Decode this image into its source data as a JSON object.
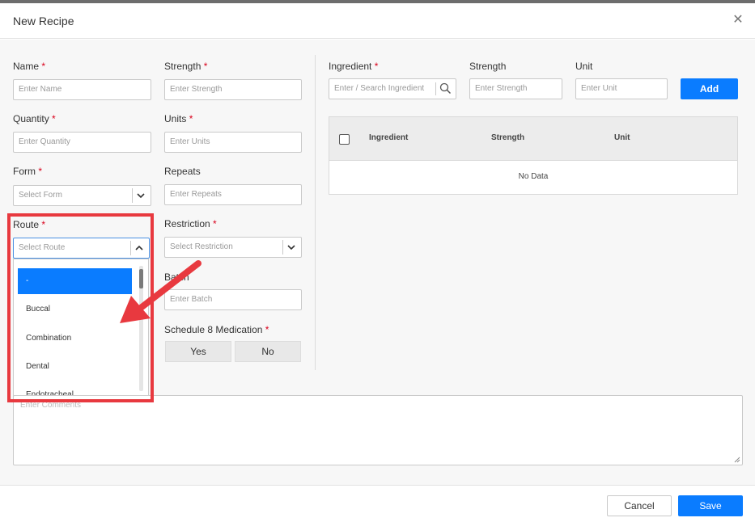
{
  "dialog": {
    "title": "New Recipe",
    "close_icon": "close-icon"
  },
  "fields": {
    "name": {
      "label": "Name",
      "required_mark": "*",
      "placeholder": "Enter Name"
    },
    "strength": {
      "label": "Strength",
      "required_mark": "*",
      "placeholder": "Enter Strength"
    },
    "quantity": {
      "label": "Quantity",
      "required_mark": "*",
      "placeholder": "Enter Quantity"
    },
    "units": {
      "label": "Units",
      "required_mark": "*",
      "placeholder": "Enter Units"
    },
    "form": {
      "label": "Form",
      "required_mark": "*",
      "placeholder": "Select Form"
    },
    "repeats": {
      "label": "Repeats",
      "placeholder": "Enter Repeats"
    },
    "route": {
      "label": "Route",
      "required_mark": "*",
      "placeholder": "Select Route"
    },
    "restriction": {
      "label": "Restriction",
      "required_mark": "*",
      "placeholder": "Select Restriction"
    },
    "batch": {
      "label": "Batch",
      "placeholder": "Enter Batch"
    },
    "schedule8": {
      "label": "Schedule 8 Medication",
      "required_mark": "*",
      "yes": "Yes",
      "no": "No"
    },
    "comments": {
      "placeholder": "Enter Comments"
    }
  },
  "ingredient_panel": {
    "ingredient_label": "Ingredient",
    "required_mark": "*",
    "ingredient_placeholder": "Enter / Search Ingredient",
    "strength_label": "Strength",
    "strength_placeholder": "Enter Strength",
    "unit_label": "Unit",
    "unit_placeholder": "Enter Unit",
    "add_label": "Add",
    "table": {
      "columns": [
        "Ingredient",
        "Strength",
        "Unit"
      ],
      "empty_text": "No Data"
    }
  },
  "route_dropdown": {
    "options": [
      "-",
      "Buccal",
      "Combination",
      "Dental",
      "Endotracheal"
    ],
    "selected": "-"
  },
  "footer": {
    "cancel_label": "Cancel",
    "save_label": "Save"
  },
  "colors": {
    "primary": "#0a7cff",
    "required": "#d9001b",
    "annotation": "#e8393f"
  }
}
